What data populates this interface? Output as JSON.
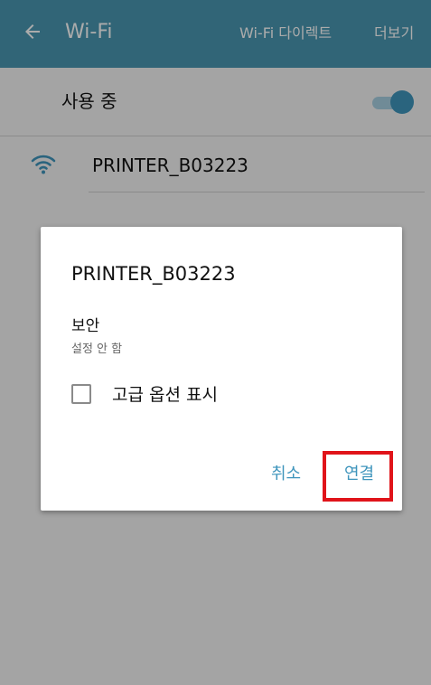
{
  "appbar": {
    "back_icon": "arrow-left-icon",
    "title": "Wi-Fi",
    "wifi_direct": "Wi-Fi 다이렉트",
    "more": "더보기"
  },
  "status": {
    "label": "사용 중",
    "toggle_on": true
  },
  "network": {
    "icon": "wifi-signal-icon",
    "ssid": "PRINTER_B03223"
  },
  "dialog": {
    "title": "PRINTER_B03223",
    "security_label": "보안",
    "security_value": "설정 안 함",
    "advanced_options_label": "고급 옵션 표시",
    "advanced_options_checked": false,
    "cancel_label": "취소",
    "connect_label": "연결"
  },
  "colors": {
    "appbar": "#4a97b2",
    "accent": "#3f95bc",
    "highlight": "#e0141a"
  }
}
